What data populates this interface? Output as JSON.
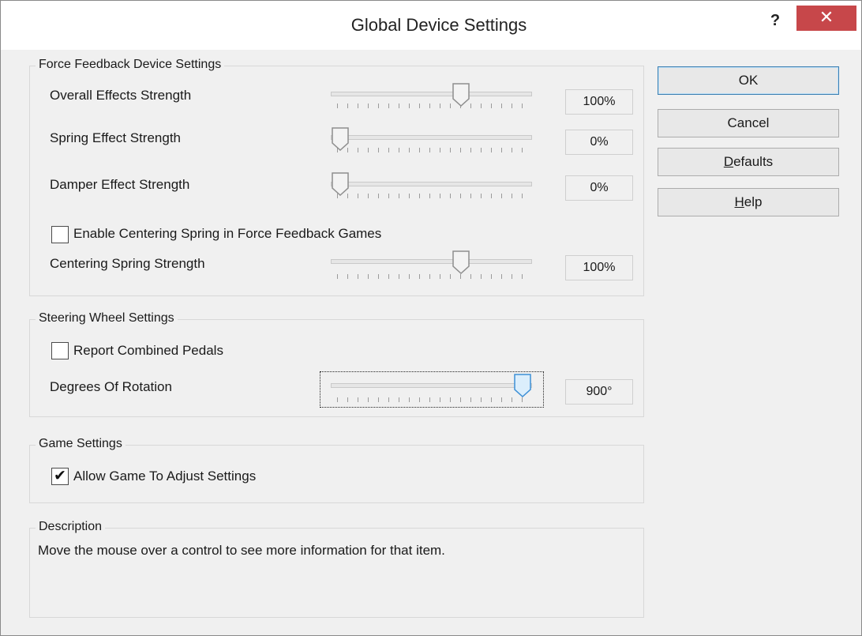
{
  "window": {
    "title": "Global Device Settings",
    "help_glyph": "?",
    "close_glyph": "✕",
    "close_color": "#c7474a"
  },
  "force_feedback": {
    "group_title": "Force Feedback Device Settings",
    "overall": {
      "label": "Overall Effects Strength",
      "value": "100%",
      "level": 0.6
    },
    "spring": {
      "label": "Spring Effect Strength",
      "value": "0%",
      "level": 0.0
    },
    "damper": {
      "label": "Damper Effect Strength",
      "value": "0%",
      "level": 0.0
    },
    "centering_checkbox": {
      "label": "Enable Centering Spring in Force Feedback Games",
      "checked": false
    },
    "centering": {
      "label": "Centering Spring Strength",
      "value": "100%",
      "level": 0.6
    }
  },
  "steering": {
    "group_title": "Steering Wheel Settings",
    "combined_pedals": {
      "label": "Report Combined Pedals",
      "checked": false
    },
    "rotation": {
      "label": "Degrees Of Rotation",
      "value": "900°",
      "level": 0.94
    }
  },
  "game": {
    "group_title": "Game Settings",
    "allow_adjust": {
      "label": "Allow Game To Adjust Settings",
      "checked": true,
      "mark": "✔"
    }
  },
  "description": {
    "group_title": "Description",
    "text": "Move the mouse over a control to see more information for that item."
  },
  "buttons": {
    "ok": "OK",
    "cancel": "Cancel",
    "defaults": "Defaults",
    "help": "Help"
  }
}
